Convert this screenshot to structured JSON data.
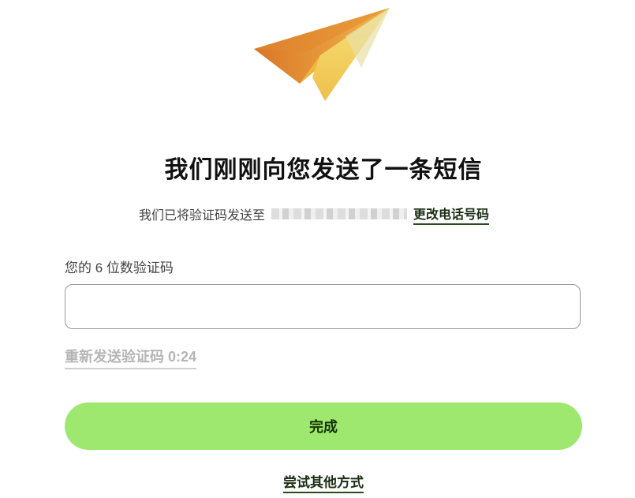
{
  "logo": {
    "icon": "paper-plane-icon"
  },
  "heading": {
    "title": "我们刚刚向您发送了一条短信"
  },
  "subtitle": {
    "text": "我们已将验证码发送至",
    "change_link": "更改电话号码"
  },
  "code_field": {
    "label": "您的 6 位数验证码",
    "value": "",
    "placeholder": ""
  },
  "resend": {
    "label": "重新发送验证码 0:24"
  },
  "done_button": {
    "label": "完成"
  },
  "other_way": {
    "label": "尝试其他方式"
  },
  "colors": {
    "primary_button": "#9fe870",
    "primary_button_text": "#163300",
    "link": "#1a2e14",
    "disabled_text": "#b5b5b5"
  }
}
